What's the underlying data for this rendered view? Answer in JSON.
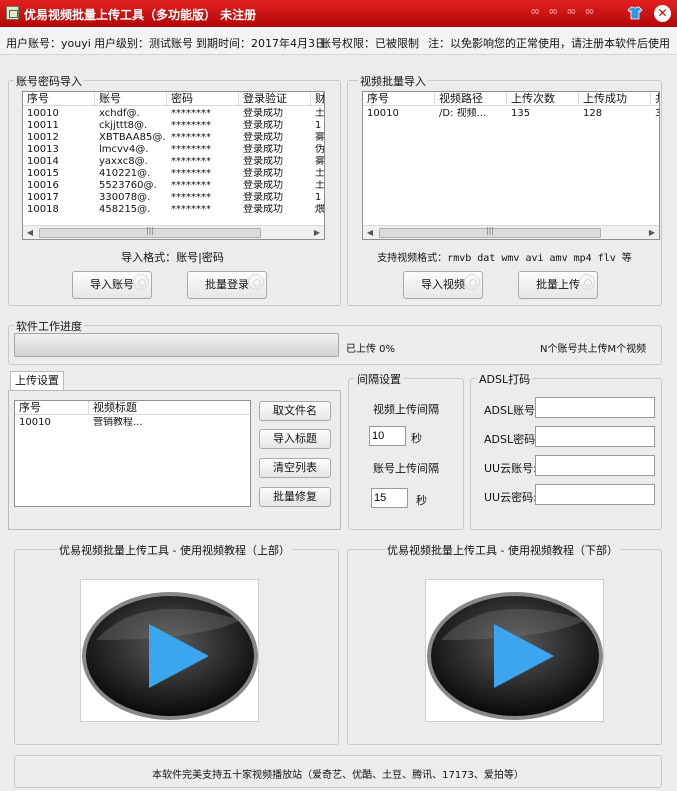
{
  "window": {
    "title": "优易视频批量上传工具（多功能版） 未注册",
    "decoration": "∞ ∞ ∞ ∞",
    "close_glyph": "✕"
  },
  "info": {
    "account": "用户账号：youyi",
    "level": "用户级别：测试账号",
    "expiry": "到期时间：2017年4月3日",
    "permission": "账号权限：已被限制",
    "notice": "注：以免影响您的正常使用，请注册本软件后使用"
  },
  "accounts": {
    "title": "账号密码导入",
    "columns": [
      "序号",
      "账号",
      "密码",
      "登录验证",
      "财"
    ],
    "rows": [
      [
        "10010",
        "xchdf@.",
        "********",
        "登录成功",
        "土"
      ],
      [
        "10011",
        "ckjjttt8@.",
        "********",
        "登录成功",
        "1"
      ],
      [
        "10012",
        "XBTBAA85@.",
        "********",
        "登录成功",
        "雾"
      ],
      [
        "10013",
        "lmcvv4@.",
        "********",
        "登录成功",
        "伪"
      ],
      [
        "10014",
        "yaxxc8@.",
        "********",
        "登录成功",
        "雾"
      ],
      [
        "10015",
        "410221@.",
        "********",
        "登录成功",
        "土"
      ],
      [
        "10016",
        "5523760@.",
        "********",
        "登录成功",
        "土"
      ],
      [
        "10017",
        "330078@.",
        "********",
        "登录成功",
        "1"
      ],
      [
        "10018",
        "458215@.",
        "********",
        "登录成功",
        "煨"
      ]
    ],
    "format_hint": "导入格式：账号|密码",
    "import_button": "导入账号",
    "login_button": "批量登录"
  },
  "videos": {
    "title": "视频批量导入",
    "columns": [
      "序号",
      "视频路径",
      "上传次数",
      "上传成功",
      "共"
    ],
    "rows": [
      [
        "10010",
        "/D: 视频...",
        "135",
        "128",
        "3"
      ]
    ],
    "format_hint": "支持视频格式：rmvb dat wmv avi amv mp4 flv 等",
    "import_button": "导入视频",
    "upload_button": "批量上传"
  },
  "progress": {
    "title": "软件工作进度",
    "value": 0,
    "status": "已上传 0%",
    "summary": "N个账号共上传M个视频"
  },
  "upload_settings": {
    "tab_label": "上传设置",
    "columns": [
      "序号",
      "视频标题"
    ],
    "rows": [
      [
        "10010",
        "营销教程..."
      ]
    ],
    "buttons": [
      "取文件名",
      "导入标题",
      "清空列表",
      "批量修复"
    ]
  },
  "interval": {
    "title": "间隔设置",
    "video_label": "视频上传间隔",
    "video_value": "10",
    "account_label": "账号上传间隔",
    "account_value": "15",
    "unit": "秒"
  },
  "adsl": {
    "title": "ADSL打码",
    "fields": [
      "ADSL账号:",
      "ADSL密码:",
      "UU云账号:",
      "UU云密码:"
    ]
  },
  "tutorials": {
    "part1": "优易视频批量上传工具 - 使用视频教程（上部）",
    "part2": "优易视频批量上传工具 - 使用视频教程（下部）"
  },
  "footer": {
    "text": "本软件完美支持五十家视频播放站（爱奇艺、优酷、土豆、腾讯、17173、爱拍等）"
  },
  "colors": {
    "titlebar": "#d01010",
    "play": "#3aa6ee"
  }
}
